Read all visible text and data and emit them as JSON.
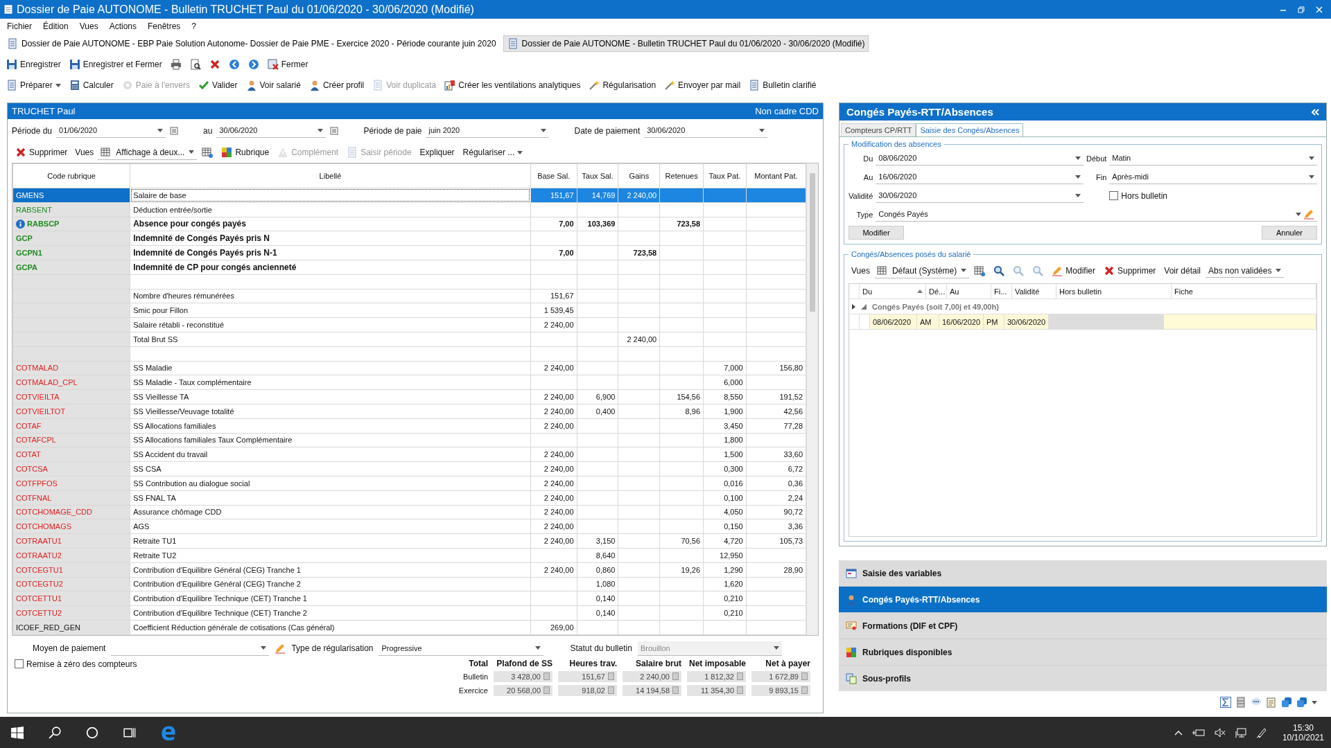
{
  "window": {
    "title": "Dossier de Paie AUTONOME - Bulletin TRUCHET Paul du 01/06/2020 - 30/06/2020 (Modifié)"
  },
  "menu": [
    "Fichier",
    "Édition",
    "Vues",
    "Actions",
    "Fenêtres",
    "?"
  ],
  "doc_tabs": [
    {
      "label": "Dossier de Paie AUTONOME - EBP Paie Solution Autonome- Dossier de Paie PME - Exercice 2020 - Période courante juin 2020",
      "selected": false
    },
    {
      "label": "Dossier de Paie AUTONOME - Bulletin TRUCHET Paul du 01/06/2020 - 30/06/2020 (Modifié)",
      "selected": true
    }
  ],
  "toolbar_1": [
    {
      "kind": "button",
      "label": "Enregistrer",
      "disabled": false
    },
    {
      "kind": "button",
      "label": "Enregistrer et Fermer",
      "disabled": false
    },
    {
      "kind": "icon",
      "disabled": false
    },
    {
      "kind": "icon",
      "disabled": false
    },
    {
      "kind": "icon",
      "disabled": false
    },
    {
      "kind": "icon",
      "disabled": false
    },
    {
      "kind": "icon",
      "disabled": false
    },
    {
      "kind": "button",
      "label": "Fermer",
      "disabled": false
    }
  ],
  "toolbar_2": [
    {
      "kind": "menu",
      "label": "Préparer",
      "disabled": false
    },
    {
      "kind": "button",
      "label": "Calculer",
      "disabled": false
    },
    {
      "kind": "button",
      "label": "Paie à l'envers",
      "disabled": true
    },
    {
      "kind": "button",
      "label": "Valider",
      "disabled": false
    },
    {
      "kind": "button",
      "label": "Voir salarié",
      "disabled": false
    },
    {
      "kind": "button",
      "label": "Créer profil",
      "disabled": false
    },
    {
      "kind": "button",
      "label": "Voir duplicata",
      "disabled": true
    },
    {
      "kind": "button",
      "label": "Créer les ventilations analytiques",
      "disabled": false
    },
    {
      "kind": "button",
      "label": "Régularisation",
      "disabled": false
    },
    {
      "kind": "button",
      "label": "Envoyer par mail",
      "disabled": false
    },
    {
      "kind": "button",
      "label": "Bulletin clarifié",
      "disabled": false
    }
  ],
  "bulletin": {
    "employee": "TRUCHET Paul",
    "contract": "Non cadre CDD",
    "filters": [
      {
        "label": "Période du",
        "value": "01/06/2020",
        "kind": "date"
      },
      {
        "label": "au",
        "value": "30/06/2020",
        "kind": "date"
      },
      {
        "label": "Période de paie",
        "value": "juin 2020",
        "kind": "select"
      },
      {
        "label": "Date de paiement",
        "value": "30/06/2020",
        "kind": "select"
      }
    ],
    "toolbar": [
      {
        "kind": "button",
        "label": "Supprimer",
        "disabled": false
      },
      {
        "kind": "label",
        "label": "Vues",
        "disabled": false
      },
      {
        "kind": "dropdown",
        "label": "Affichage à deux...",
        "disabled": false
      },
      {
        "kind": "icon",
        "disabled": false
      },
      {
        "kind": "button",
        "label": "Rubrique",
        "disabled": false
      },
      {
        "kind": "button",
        "label": "Complément",
        "disabled": true
      },
      {
        "kind": "button",
        "label": "Saisir période",
        "disabled": true
      },
      {
        "kind": "button",
        "label": "Expliquer",
        "disabled": false
      },
      {
        "kind": "menu",
        "label": "Régulariser ...",
        "disabled": false
      }
    ],
    "table": {
      "columns": [
        "Code rubrique",
        "Libellé",
        "Base Sal.",
        "Taux Sal.",
        "Gains",
        "Retenues",
        "Taux Pat.",
        "Montant Pat."
      ],
      "rows": [
        {
          "code": "GMENS",
          "label": "Salaire de base",
          "values": {
            "base": "151,67",
            "taux_sal": "14,769",
            "gains": "2 240,00"
          },
          "kind": "gain",
          "bold": false,
          "info": false,
          "selected": true
        },
        {
          "code": "RABSENT",
          "label": "Déduction entrée/sortie",
          "kind": "gain",
          "bold": false,
          "info": false,
          "selected": false
        },
        {
          "code": "RABSCP",
          "label": "Absence pour congés payés",
          "values": {
            "base": "7,00",
            "taux_sal": "103,369",
            "retenues": "723,58"
          },
          "kind": "gain",
          "bold": true,
          "info": true,
          "selected": false
        },
        {
          "code": "GCP",
          "label": "Indemnité de Congés Payés pris N",
          "kind": "gain",
          "bold": true,
          "info": false,
          "selected": false
        },
        {
          "code": "GCPN1",
          "label": "Indemnité de Congés Payés pris N-1",
          "values": {
            "base": "7,00",
            "gains": "723,58"
          },
          "kind": "gain",
          "bold": true,
          "info": false,
          "selected": false
        },
        {
          "code": "GCPA",
          "label": "Indemnité de CP pour congés ancienneté",
          "kind": "gain",
          "bold": true,
          "info": false,
          "selected": false
        },
        {
          "kind": "blank",
          "bold": false,
          "info": false,
          "selected": false
        },
        {
          "label": "Nombre d'heures rémunérées",
          "values": {
            "base": "151,67"
          },
          "kind": "info",
          "bold": false,
          "info": false,
          "selected": false
        },
        {
          "label": "Smic pour Fillon",
          "values": {
            "base": "1 539,45"
          },
          "kind": "info",
          "bold": false,
          "info": false,
          "selected": false
        },
        {
          "label": "Salaire rétabli - reconstitué",
          "values": {
            "base": "2 240,00"
          },
          "kind": "info",
          "bold": false,
          "info": false,
          "selected": false
        },
        {
          "label": "Total Brut SS",
          "values": {
            "gains": "2 240,00"
          },
          "kind": "info",
          "bold": false,
          "info": false,
          "selected": false
        },
        {
          "kind": "blank",
          "bold": false,
          "info": false,
          "selected": false
        },
        {
          "code": "COTMALAD",
          "label": "SS Maladie",
          "values": {
            "base": "2 240,00",
            "taux_pat": "7,000",
            "montant_pat": "156,80"
          },
          "kind": "cotisation",
          "bold": false,
          "info": false,
          "selected": false
        },
        {
          "code": "COTMALAD_CPL",
          "label": "SS Maladie - Taux complémentaire",
          "values": {
            "taux_pat": "6,000"
          },
          "kind": "cotisation",
          "bold": false,
          "info": false,
          "selected": false
        },
        {
          "code": "COTVIEILTA",
          "label": "SS Vieillesse TA",
          "values": {
            "base": "2 240,00",
            "taux_sal": "6,900",
            "retenues": "154,56",
            "taux_pat": "8,550",
            "montant_pat": "191,52"
          },
          "kind": "cotisation",
          "bold": false,
          "info": false,
          "selected": false
        },
        {
          "code": "COTVIEILTOT",
          "label": "SS Vieillesse/Veuvage totalité",
          "values": {
            "base": "2 240,00",
            "taux_sal": "0,400",
            "retenues": "8,96",
            "taux_pat": "1,900",
            "montant_pat": "42,56"
          },
          "kind": "cotisation",
          "bold": false,
          "info": false,
          "selected": false
        },
        {
          "code": "COTAF",
          "label": "SS Allocations familiales",
          "values": {
            "base": "2 240,00",
            "taux_pat": "3,450",
            "montant_pat": "77,28"
          },
          "kind": "cotisation",
          "bold": false,
          "info": false,
          "selected": false
        },
        {
          "code": "COTAFCPL",
          "label": "SS Allocations familiales Taux Complémentaire",
          "values": {
            "taux_pat": "1,800"
          },
          "kind": "cotisation",
          "bold": false,
          "info": false,
          "selected": false
        },
        {
          "code": "COTAT",
          "label": "SS Accident du travail",
          "values": {
            "base": "2 240,00",
            "taux_pat": "1,500",
            "montant_pat": "33,60"
          },
          "kind": "cotisation",
          "bold": false,
          "info": false,
          "selected": false
        },
        {
          "code": "COTCSA",
          "label": "SS CSA",
          "values": {
            "base": "2 240,00",
            "taux_pat": "0,300",
            "montant_pat": "6,72"
          },
          "kind": "cotisation",
          "bold": false,
          "info": false,
          "selected": false
        },
        {
          "code": "COTFPFOS",
          "label": "SS Contribution au dialogue social",
          "values": {
            "base": "2 240,00",
            "taux_pat": "0,016",
            "montant_pat": "0,36"
          },
          "kind": "cotisation",
          "bold": false,
          "info": false,
          "selected": false
        },
        {
          "code": "COTFNAL",
          "label": "SS FNAL TA",
          "values": {
            "base": "2 240,00",
            "taux_pat": "0,100",
            "montant_pat": "2,24"
          },
          "kind": "cotisation",
          "bold": false,
          "info": false,
          "selected": false
        },
        {
          "code": "COTCHOMAGE_CDD",
          "label": "Assurance chômage CDD",
          "values": {
            "base": "2 240,00",
            "taux_pat": "4,050",
            "montant_pat": "90,72"
          },
          "kind": "cotisation",
          "bold": false,
          "info": false,
          "selected": false
        },
        {
          "code": "COTCHOMAGS",
          "label": "AGS",
          "values": {
            "base": "2 240,00",
            "taux_pat": "0,150",
            "montant_pat": "3,36"
          },
          "kind": "cotisation",
          "bold": false,
          "info": false,
          "selected": false
        },
        {
          "code": "COTRAATU1",
          "label": "Retraite TU1",
          "values": {
            "base": "2 240,00",
            "taux_sal": "3,150",
            "retenues": "70,56",
            "taux_pat": "4,720",
            "montant_pat": "105,73"
          },
          "kind": "cotisation",
          "bold": false,
          "info": false,
          "selected": false
        },
        {
          "code": "COTRAATU2",
          "label": "Retraite TU2",
          "values": {
            "taux_sal": "8,640",
            "taux_pat": "12,950"
          },
          "kind": "cotisation",
          "bold": false,
          "info": false,
          "selected": false
        },
        {
          "code": "COTCEGTU1",
          "label": "Contribution d'Equilibre Général (CEG) Tranche 1",
          "values": {
            "base": "2 240,00",
            "taux_sal": "0,860",
            "retenues": "19,26",
            "taux_pat": "1,290",
            "montant_pat": "28,90"
          },
          "kind": "cotisation",
          "bold": false,
          "info": false,
          "selected": false
        },
        {
          "code": "COTCEGTU2",
          "label": "Contribution d'Equilibre Général (CEG) Tranche 2",
          "values": {
            "taux_sal": "1,080",
            "taux_pat": "1,620"
          },
          "kind": "cotisation",
          "bold": false,
          "info": false,
          "selected": false
        },
        {
          "code": "COTCETTU1",
          "label": "Contribution d'Equilibre Technique (CET) Tranche 1",
          "values": {
            "taux_sal": "0,140",
            "taux_pat": "0,210"
          },
          "kind": "cotisation",
          "bold": false,
          "info": false,
          "selected": false
        },
        {
          "code": "COTCETTU2",
          "label": "Contribution d'Equilibre Technique (CET) Tranche 2",
          "values": {
            "taux_sal": "0,140",
            "taux_pat": "0,210"
          },
          "kind": "cotisation",
          "bold": false,
          "info": false,
          "selected": false
        },
        {
          "code": "ICOEF_RED_GEN",
          "label": "Coefficient Réduction générale de cotisations (Cas général)",
          "values": {
            "base": "269,00"
          },
          "kind": "coefficient",
          "bold": false,
          "info": false,
          "selected": false
        }
      ]
    },
    "payment": {
      "label": "Moyen de paiement"
    },
    "regularisation": {
      "label": "Type de régularisation",
      "value": "Progressive"
    },
    "status": {
      "label": "Statut du bulletin",
      "value": "Brouillon",
      "disabled": true
    },
    "reset_counters": {
      "label": "Remise à zéro des compteurs",
      "checked": false
    },
    "totals": {
      "columns": [
        "Total",
        "Plafond de SS",
        "Heures trav.",
        "Salaire brut",
        "Net imposable",
        "Net à payer"
      ],
      "rows": [
        {
          "label": "Bulletin",
          "values": [
            "3 428,00",
            "151,67",
            "2 240,00",
            "1 812,32",
            "1 672,89"
          ]
        },
        {
          "label": "Exercice",
          "values": [
            "20 568,00",
            "918,02",
            "14 194,58",
            "11 354,30",
            "9 893,15"
          ]
        }
      ]
    }
  },
  "side_panel": {
    "title": "Congés Payés-RTT/Absences",
    "tabs": [
      {
        "label": "Compteurs CP/RTT",
        "selected": false
      },
      {
        "label": "Saisie des Congés/Absences",
        "selected": true
      }
    ],
    "edit_group": {
      "title": "Modification des absences",
      "du": {
        "label": "Du",
        "value": "08/06/2020"
      },
      "au": {
        "label": "Au",
        "value": "16/06/2020"
      },
      "validite": {
        "label": "Validité",
        "value": "30/06/2020"
      },
      "debut": {
        "label": "Début",
        "value": "Matin"
      },
      "fin": {
        "label": "Fin",
        "value": "Après-midi"
      },
      "hors_bulletin": {
        "label": "Hors bulletin",
        "checked": false
      },
      "type": {
        "label": "Type",
        "value": "Congés Payés"
      },
      "buttons": [
        "Modifier",
        "Annuler"
      ]
    },
    "list_group": {
      "title": "Congés/Absences posés du salarié",
      "toolbar": [
        {
          "kind": "label",
          "label": "Vues",
          "disabled": false
        },
        {
          "kind": "dropdown",
          "label": "Défaut (Système)",
          "disabled": false
        },
        {
          "kind": "icon",
          "disabled": false
        },
        {
          "kind": "icon",
          "disabled": false
        },
        {
          "kind": "icon",
          "disabled": true
        },
        {
          "kind": "icon",
          "disabled": true
        },
        {
          "kind": "button",
          "label": "Modifier",
          "disabled": false
        },
        {
          "kind": "button",
          "label": "Supprimer",
          "disabled": false
        },
        {
          "kind": "button",
          "label": "Voir détail",
          "disabled": false
        },
        {
          "kind": "dropdown",
          "label": "Abs non validées",
          "disabled": false
        }
      ],
      "columns": [
        "Du",
        "Dé...",
        "Au",
        "Fi...",
        "Validité",
        "Hors bulletin",
        "Fiche"
      ],
      "group": {
        "label": "Congés Payés (soit 7,00j et 49,00h)",
        "expanded": true
      },
      "rows": [
        {
          "cells": [
            "08/06/2020",
            "AM",
            "16/06/2020",
            "PM",
            "30/06/2020"
          ]
        }
      ]
    }
  },
  "nav": [
    {
      "label": "Saisie des variables",
      "selected": false
    },
    {
      "label": "Congés Payés-RTT/Absences",
      "selected": true
    },
    {
      "label": "Formations (DIF et CPF)",
      "selected": false
    },
    {
      "label": "Rubriques disponibles",
      "selected": false
    },
    {
      "label": "Sous-profils",
      "selected": false
    }
  ],
  "taskbar": {
    "time": "15:30",
    "date": "10/10/2021"
  }
}
